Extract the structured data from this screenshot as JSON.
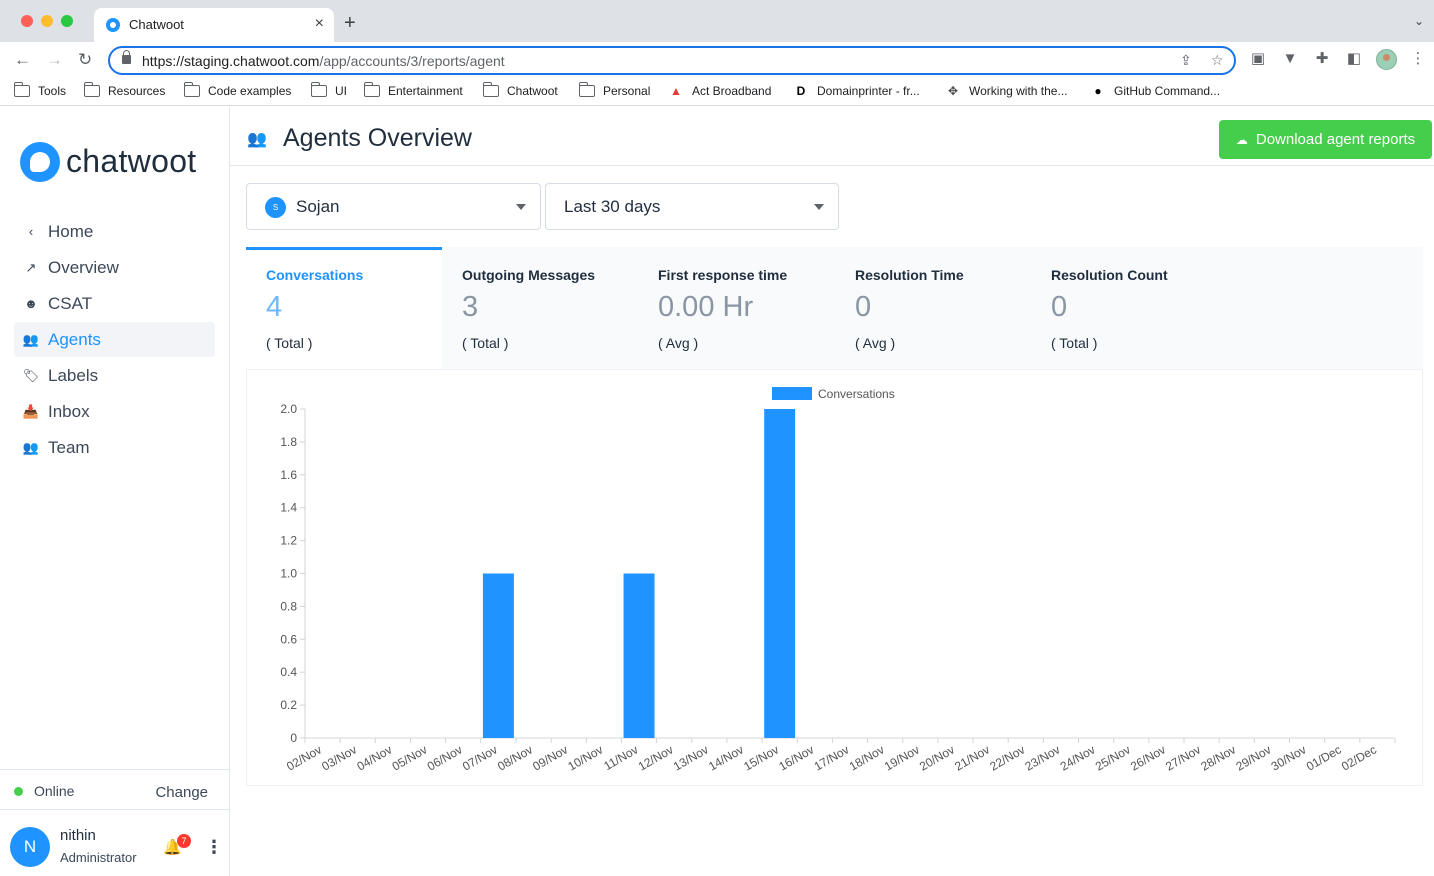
{
  "browser": {
    "tab_title": "Chatwoot",
    "tab_close": "×",
    "new_tab": "+",
    "tab_menu": "⌄",
    "url_host": "https://staging.chatwoot.com",
    "url_path": "/app/accounts/3/reports/agent",
    "bookmarks": [
      {
        "label": "Tools",
        "icon": "folder-icon"
      },
      {
        "label": "Resources",
        "icon": "folder-icon"
      },
      {
        "label": "Code examples",
        "icon": "folder-icon"
      },
      {
        "label": "UI",
        "icon": "folder-icon"
      },
      {
        "label": "Entertainment",
        "icon": "folder-icon"
      },
      {
        "label": "Chatwoot",
        "icon": "folder-icon"
      },
      {
        "label": "Personal",
        "icon": "folder-icon"
      },
      {
        "label": "Act Broadband",
        "icon": "act-logo-icon"
      },
      {
        "label": "Domainprinter - fr...",
        "icon": "domainprinter-icon"
      },
      {
        "label": "Working with the...",
        "icon": "bird-icon"
      },
      {
        "label": "GitHub Command...",
        "icon": "github-icon"
      }
    ]
  },
  "brand": {
    "name": "chatwoot",
    "accent": "#1f93ff",
    "success": "#44ce4b"
  },
  "sidebar": {
    "items": [
      {
        "label": "Home",
        "icon": "‹"
      },
      {
        "label": "Overview",
        "icon": "↗"
      },
      {
        "label": "CSAT",
        "icon": "☻"
      },
      {
        "label": "Agents",
        "icon": "👥"
      },
      {
        "label": "Labels",
        "icon": "🏷"
      },
      {
        "label": "Inbox",
        "icon": "📥"
      },
      {
        "label": "Team",
        "icon": "👥"
      }
    ],
    "active_item": "Agents",
    "status": "Online",
    "change_label": "Change",
    "user": {
      "initial": "N",
      "name": "nithin",
      "role": "Administrator",
      "notification_count": "7"
    }
  },
  "header": {
    "title": "Agents Overview",
    "download_label": "Download agent reports"
  },
  "filters": {
    "agent": {
      "value": "Sojan",
      "avatar_initial": "S"
    },
    "range": {
      "value": "Last 30 days"
    }
  },
  "metrics": [
    {
      "label": "Conversations",
      "value": "4",
      "sub": "( Total )"
    },
    {
      "label": "Outgoing Messages",
      "value": "3",
      "sub": "( Total )"
    },
    {
      "label": "First response time",
      "value": "0.00 Hr",
      "sub": "( Avg )"
    },
    {
      "label": "Resolution Time",
      "value": "0",
      "sub": "( Avg )"
    },
    {
      "label": "Resolution Count",
      "value": "0",
      "sub": "( Total )"
    }
  ],
  "chart_data": {
    "type": "bar",
    "legend": [
      "Conversations"
    ],
    "legend_position": "top-center",
    "series": [
      {
        "name": "Conversations",
        "color": "#1f93ff",
        "values": [
          0,
          0,
          0,
          0,
          0,
          1,
          0,
          0,
          0,
          1,
          0,
          0,
          0,
          2,
          0,
          0,
          0,
          0,
          0,
          0,
          0,
          0,
          0,
          0,
          0,
          0,
          0,
          0,
          0,
          0,
          0
        ]
      }
    ],
    "categories": [
      "02/Nov",
      "03/Nov",
      "04/Nov",
      "05/Nov",
      "06/Nov",
      "07/Nov",
      "08/Nov",
      "09/Nov",
      "10/Nov",
      "11/Nov",
      "12/Nov",
      "13/Nov",
      "14/Nov",
      "15/Nov",
      "16/Nov",
      "17/Nov",
      "18/Nov",
      "19/Nov",
      "20/Nov",
      "21/Nov",
      "22/Nov",
      "23/Nov",
      "24/Nov",
      "25/Nov",
      "26/Nov",
      "27/Nov",
      "28/Nov",
      "29/Nov",
      "30/Nov",
      "01/Dec",
      "02/Dec"
    ],
    "yticks": [
      "0",
      "0.2",
      "0.4",
      "0.6",
      "0.8",
      "1.0",
      "1.2",
      "1.4",
      "1.6",
      "1.8",
      "2.0"
    ],
    "ylim": [
      0,
      2
    ],
    "xlabel": "",
    "ylabel": "",
    "grid": false
  }
}
